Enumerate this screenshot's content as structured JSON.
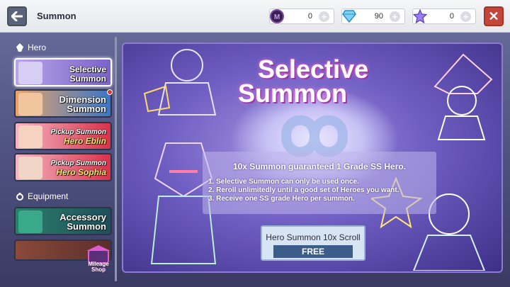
{
  "header": {
    "title": "Summon",
    "currencies": [
      {
        "icon": "purple-coin-icon",
        "value": "0"
      },
      {
        "icon": "diamond-icon",
        "value": "90"
      },
      {
        "icon": "star-ticket-icon",
        "value": "0"
      }
    ]
  },
  "sidebar": {
    "hero_section": "Hero",
    "equipment_section": "Equipment",
    "items": [
      {
        "label_line1": "Selective",
        "label_line2": "Summon"
      },
      {
        "label_line1": "Dimension",
        "label_line2": "Summon"
      },
      {
        "label_line1": "Pickup Summon",
        "label_line2": "Hero Eblin"
      },
      {
        "label_line1": "Pickup Summon",
        "label_line2": "Hero Sophia"
      },
      {
        "label_line1": "Accessory",
        "label_line2": "Summon"
      }
    ],
    "mileage_line1": "Mileage",
    "mileage_line2": "Shop"
  },
  "main": {
    "title_line1": "Selective",
    "title_line2": "Summon",
    "info_head": "10x Summon guaranteed 1 Grade SS Hero.",
    "info_lines": [
      "1. Selective Summon can only be used once.",
      "2. Reroll unlimitedly until a good set of Heroes you want.",
      "3. Receive one SS grade Hero per summon."
    ],
    "button_label": "Hero Summon 10x Scroll",
    "button_price": "FREE"
  },
  "colors": {
    "accent_purple": "#6f5ec2",
    "close_red": "#c4453a",
    "button_blue": "#3c5d8a"
  }
}
